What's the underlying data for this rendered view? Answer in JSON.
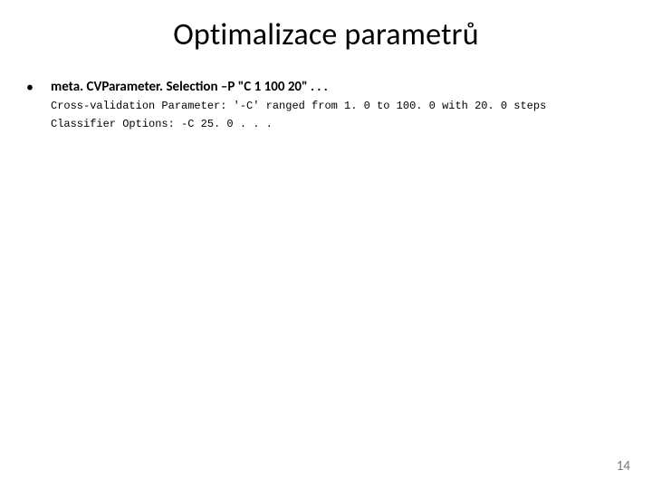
{
  "title": "Optimalizace parametrů",
  "bullet": {
    "marker": "•",
    "heading": "meta. CVParameter. Selection –P \"C 1 100 20\" . . .",
    "mono_line1": "Cross-validation Parameter: '-C' ranged from 1. 0 to 100. 0 with 20. 0 steps",
    "mono_line2": "Classifier Options: -C 25. 0 . . ."
  },
  "page_number": "14"
}
